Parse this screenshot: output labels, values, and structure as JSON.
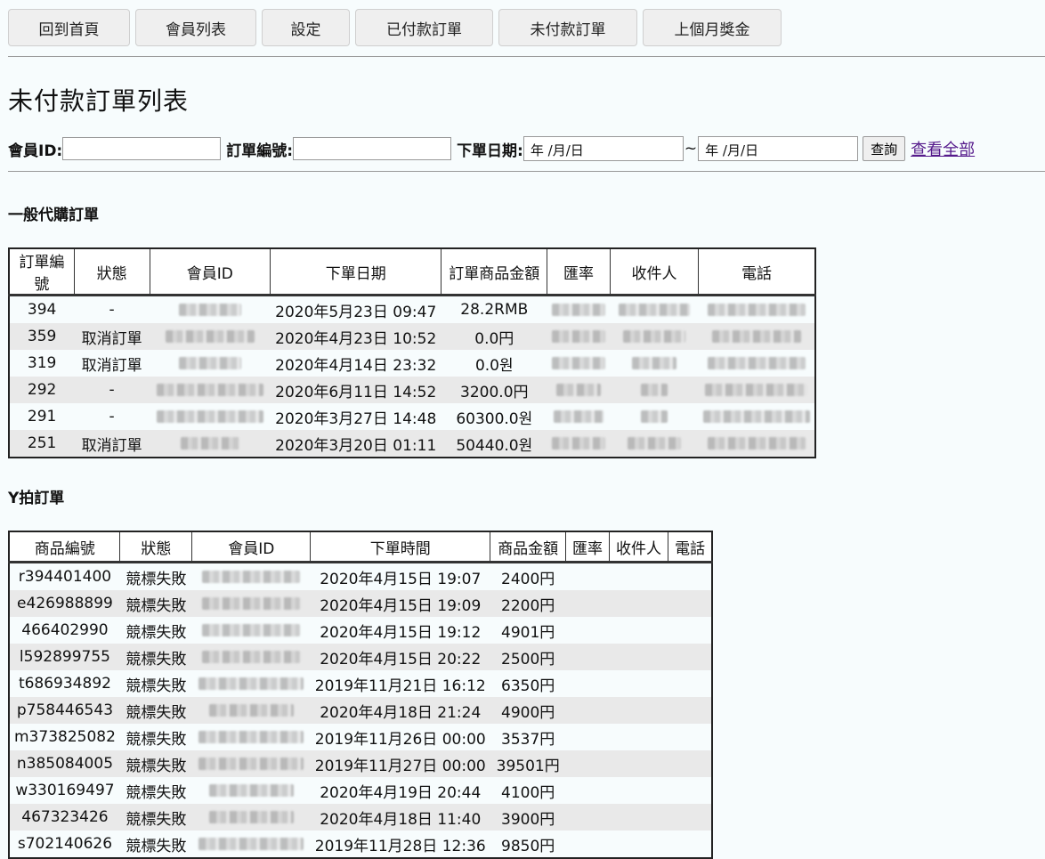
{
  "nav": [
    "回到首頁",
    "會員列表",
    "設定",
    "已付款訂單",
    "未付款訂單",
    "上個月獎金"
  ],
  "page_title": "未付款訂單列表",
  "search": {
    "member_label": "會員ID:",
    "order_label": "訂單編號:",
    "date_label": "下單日期:",
    "date_placeholder": "年 /月/日",
    "tilde": "~",
    "query_button": "查詢",
    "view_all": "查看全部"
  },
  "section1": {
    "title": "一般代購訂單",
    "headers": [
      "訂單編號",
      "狀態",
      "會員ID",
      "下單日期",
      "訂單商品金額",
      "匯率",
      "收件人",
      "電話"
    ],
    "rows": [
      {
        "id": "394",
        "status": "-",
        "date": "2020年5月23日 09:47",
        "amount": "28.2RMB"
      },
      {
        "id": "359",
        "status": "取消訂單",
        "date": "2020年4月23日 10:52",
        "amount": "0.0円"
      },
      {
        "id": "319",
        "status": "取消訂單",
        "date": "2020年4月14日 23:32",
        "amount": "0.0원"
      },
      {
        "id": "292",
        "status": "-",
        "date": "2020年6月11日 14:52",
        "amount": "3200.0円"
      },
      {
        "id": "291",
        "status": "-",
        "date": "2020年3月27日 14:48",
        "amount": "60300.0원"
      },
      {
        "id": "251",
        "status": "取消訂單",
        "date": "2020年3月20日 01:11",
        "amount": "50440.0원"
      }
    ]
  },
  "section2": {
    "title": "Y拍訂單",
    "headers": [
      "商品編號",
      "狀態",
      "會員ID",
      "下單時間",
      "商品金額",
      "匯率",
      "收件人",
      "電話"
    ],
    "rows": [
      {
        "id": "r394401400",
        "status": "競標失敗",
        "date": "2020年4月15日 19:07",
        "amount": "2400円"
      },
      {
        "id": "e426988899",
        "status": "競標失敗",
        "date": "2020年4月15日 19:09",
        "amount": "2200円"
      },
      {
        "id": "466402990",
        "status": "競標失敗",
        "date": "2020年4月15日 19:12",
        "amount": "4901円"
      },
      {
        "id": "l592899755",
        "status": "競標失敗",
        "date": "2020年4月15日 20:22",
        "amount": "2500円"
      },
      {
        "id": "t686934892",
        "status": "競標失敗",
        "date": "2019年11月21日 16:12",
        "amount": "6350円"
      },
      {
        "id": "p758446543",
        "status": "競標失敗",
        "date": "2020年4月18日 21:24",
        "amount": "4900円"
      },
      {
        "id": "m373825082",
        "status": "競標失敗",
        "date": "2019年11月26日 00:00",
        "amount": "3537円"
      },
      {
        "id": "n385084005",
        "status": "競標失敗",
        "date": "2019年11月27日 00:00",
        "amount": "39501円"
      },
      {
        "id": "w330169497",
        "status": "競標失敗",
        "date": "2020年4月19日 20:44",
        "amount": "4100円"
      },
      {
        "id": "467323426",
        "status": "競標失敗",
        "date": "2020年4月18日 11:40",
        "amount": "3900円"
      },
      {
        "id": "s702140626",
        "status": "競標失敗",
        "date": "2019年11月28日 12:36",
        "amount": "9850円"
      }
    ]
  }
}
